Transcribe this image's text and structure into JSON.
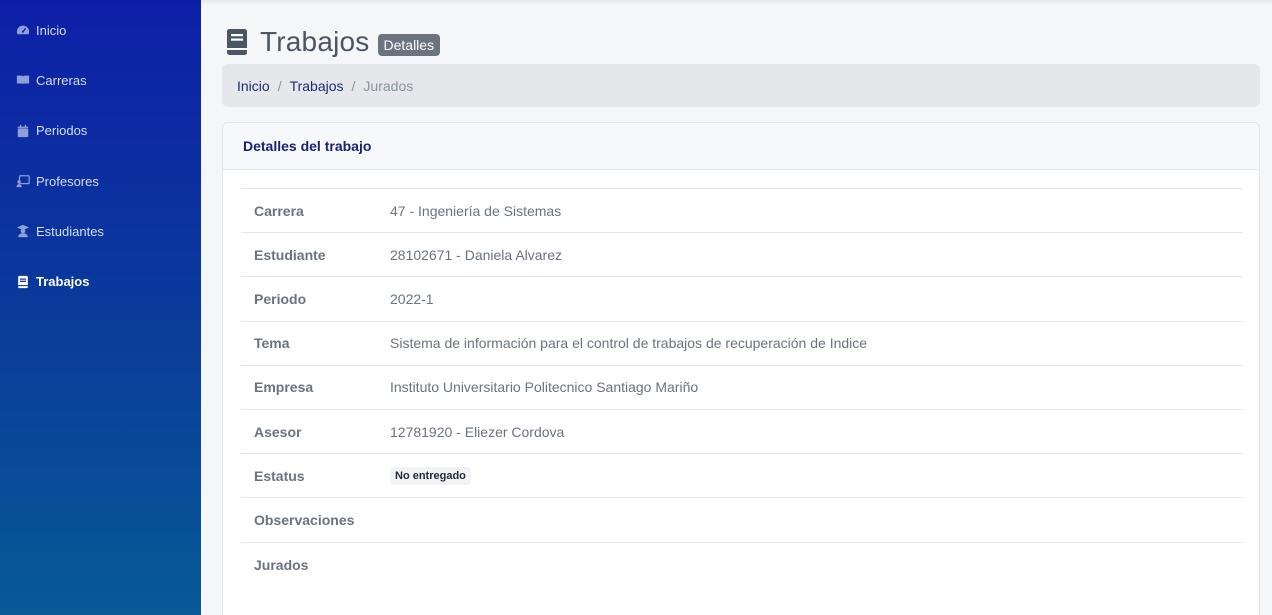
{
  "sidebar": {
    "items": [
      {
        "label": "Inicio",
        "icon": "dashboard-icon"
      },
      {
        "label": "Carreras",
        "icon": "book-open-icon"
      },
      {
        "label": "Periodos",
        "icon": "calendar-icon"
      },
      {
        "label": "Profesores",
        "icon": "chalkboard-teacher-icon"
      },
      {
        "label": "Estudiantes",
        "icon": "student-icon"
      },
      {
        "label": "Trabajos",
        "icon": "book-icon",
        "active": true
      }
    ]
  },
  "header": {
    "title": "Trabajos",
    "badge": "Detalles"
  },
  "breadcrumb": {
    "items": [
      "Inicio",
      "Trabajos"
    ],
    "current": "Jurados",
    "separator": "/"
  },
  "card": {
    "title": "Detalles del trabajo",
    "rows": [
      {
        "label": "Carrera",
        "value": "47 - Ingeniería de Sistemas"
      },
      {
        "label": "Estudiante",
        "value": "28102671 - Daniela Alvarez"
      },
      {
        "label": "Periodo",
        "value": "2022-1"
      },
      {
        "label": "Tema",
        "value": "Sistema de información para el control de trabajos de recuperación de Indice"
      },
      {
        "label": "Empresa",
        "value": "Instituto Universitario Politecnico Santiago Mariño"
      },
      {
        "label": "Asesor",
        "value": "12781920 - Eliezer Cordova"
      },
      {
        "label": "Estatus",
        "value": "No entregado"
      },
      {
        "label": "Observaciones",
        "value": ""
      },
      {
        "label": "Jurados",
        "value": ""
      }
    ]
  },
  "colors": {
    "sidebar_top": "#0d1fa8",
    "sidebar_bottom": "#075a96",
    "link": "#1e2a78",
    "badge": "#6b7280"
  }
}
